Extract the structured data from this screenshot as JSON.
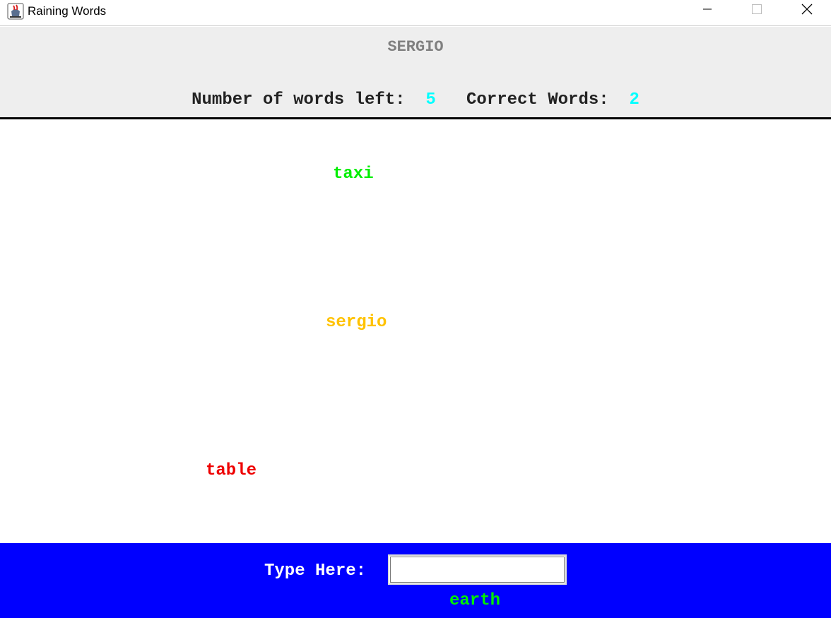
{
  "window": {
    "title": "Raining Words",
    "app_icon": "java-cup-icon",
    "controls": {
      "minimize": "minimize-icon",
      "maximize": "maximize-icon",
      "close": "close-icon"
    }
  },
  "header": {
    "player_name": "SERGIO",
    "words_left_label": "Number of words left:",
    "words_left_value": "5",
    "correct_words_label": "Correct Words:",
    "correct_words_value": "2",
    "value_color": "#00ffff"
  },
  "play_area": {
    "words": [
      {
        "text": "taxi",
        "color": "#00ee00"
      },
      {
        "text": "sergio",
        "color": "#ffc200"
      },
      {
        "text": "table",
        "color": "#ee0000"
      }
    ]
  },
  "input_bar": {
    "label": "Type Here:",
    "input_value": "",
    "feedback_word": "earth",
    "feedback_color": "#00ee00",
    "background": "#0000ff"
  }
}
